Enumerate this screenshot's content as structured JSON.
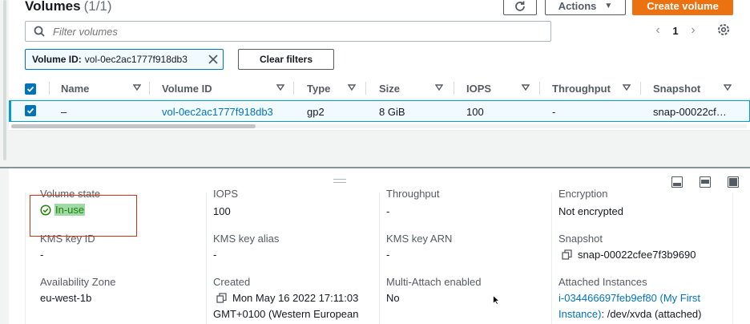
{
  "header": {
    "title": "Volumes",
    "count": "(1/1)",
    "actions_label": "Actions",
    "create_label": "Create volume"
  },
  "search": {
    "placeholder": "Filter volumes"
  },
  "pagination": {
    "current_page": "1"
  },
  "filter_token": {
    "key": "Volume ID:",
    "value": "vol-0ec2ac1777f918db3"
  },
  "clear_filters_label": "Clear filters",
  "table": {
    "columns": [
      "Name",
      "Volume ID",
      "Type",
      "Size",
      "IOPS",
      "Throughput",
      "Snapshot"
    ],
    "rows": [
      {
        "name": "–",
        "volume_id": "vol-0ec2ac1777f918db3",
        "type": "gp2",
        "size": "8 GiB",
        "iops": "100",
        "throughput": "-",
        "snapshot": "snap-00022cf…"
      }
    ]
  },
  "details": {
    "col1": {
      "cut_label": "Volume state",
      "state": "In-use",
      "kms_key_id_label": "KMS key ID",
      "kms_key_id": "-",
      "az_label": "Availability Zone",
      "az": "eu-west-1b"
    },
    "col2": {
      "cut_label": "IOPS",
      "iops": "100",
      "kms_alias_label": "KMS key alias",
      "kms_alias": "-",
      "created_label": "Created",
      "created_line1": "Mon May 16 2022 17:11:03",
      "created_line2": "GMT+0100 (Western European"
    },
    "col3": {
      "cut_label": "Throughput",
      "throughput": "-",
      "kms_arn_label": "KMS key ARN",
      "kms_arn": "-",
      "multi_attach_label": "Multi-Attach enabled",
      "multi_attach": "No"
    },
    "col4": {
      "cut_label": "Encryption",
      "encryption": "Not encrypted",
      "snapshot_label": "Snapshot",
      "snapshot": "snap-00022cfee7f3b9690",
      "attached_label": "Attached Instances",
      "attached_link_line1": "i-034466697feb9ef80 (My First",
      "attached_link_line2": "Instance)",
      "attached_suffix": ": /dev/xvda (attached)"
    }
  },
  "colors": {
    "primary_orange": "#ec7211",
    "link_blue": "#0073bb",
    "success_green": "#1d8102",
    "highlight_red": "#d13212"
  }
}
